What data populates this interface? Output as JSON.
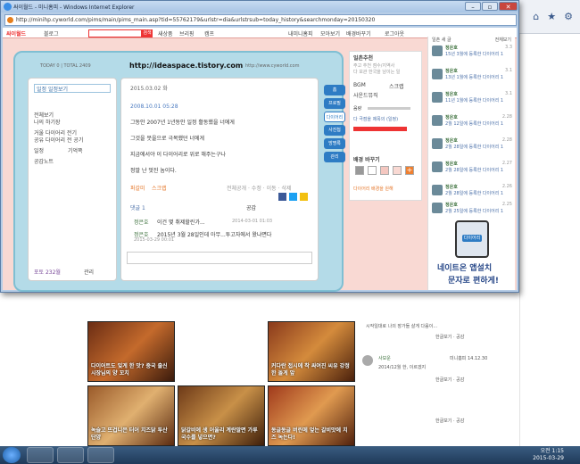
{
  "browser": {
    "window_title": "싸이월드 - 미니홈피 - Windows Internet Explorer",
    "address": "http://minihp.cyworld.com/pims/main/pims_main.asp?tid=55762179&urlstr=dia&urlstrsub=today_history&searchmonday=20150320",
    "minimize": "–",
    "restore": "▫",
    "close": "✕"
  },
  "cyworld_bar": {
    "logo": "싸이월드",
    "blog": "블로그",
    "search_button": "검색",
    "links": [
      "새상품",
      "브리핑",
      "캠프"
    ],
    "right_links": [
      "내미니홈피",
      "모아보기",
      "배경바꾸기",
      "로그아웃"
    ]
  },
  "minihompy": {
    "visitor": "TODAY 0 | TOTAL 2409",
    "url": "http://ideaspace.tistory.com",
    "domain": "http://www.cyworld.com",
    "folder_label": "일정 일정보기",
    "left_menu": [
      "전체보기",
      "나의 하기장",
      "거울 다이어리 전기",
      "공유 다이어리 전 공기",
      "일정",
      "기억쪽",
      "공감노트"
    ],
    "tabs": [
      "홈",
      "프로필",
      "다이어리",
      "사진첩",
      "방명록",
      "관리"
    ],
    "photo_count": "포토 232월",
    "admin": "관리",
    "post": {
      "header_date": "2015.03.02 화",
      "datetime": "2008.10.01 05:28",
      "lines": [
        "그동안 2007년 1년동안 일정 활동했을 너에게",
        "그것을 뭇을으로 극복했던 너에게",
        "지금에서야 이 다이어리로 위로 해주는구나",
        "정말 난 멋진 놈이다."
      ],
      "actions": [
        "퍼갈미",
        "스크랩"
      ],
      "controls": "전체공개 · 수정 · 이동 · 삭제",
      "comment_label": "댓글 1",
      "like": "공감",
      "comments": [
        {
          "author": "정은호",
          "text": "이건 몇 취제할린가...",
          "date": "2014-03-01 01:03"
        },
        {
          "author": "정은호",
          "text": "2015년 3월 28일인데 아무...투고자에서 왔냐면다",
          "date": "2015-03-29 00:01"
        }
      ]
    }
  },
  "right_panel": {
    "title": "일촌추천",
    "desc": [
      "주고 추천 점수/지역사",
      "다 보관 한국을 남이는 일"
    ],
    "bgm": "BGM",
    "scrap": "스크랩",
    "music": "사운드뮤직",
    "volume": "음량",
    "player": "다 극점을 제목의 (일정)",
    "skin": "배경 바꾸기",
    "footer": "다이어리 배경을 원해"
  },
  "friends": {
    "header": "일촌 새 글",
    "more": "전체보기",
    "items": [
      {
        "name": "정은호",
        "msg": "15년 3월에 등록한 다이어리 1",
        "date": "3.3"
      },
      {
        "name": "정은호",
        "msg": "13년 1월에 등록한 다이어리 1",
        "date": "3.1"
      },
      {
        "name": "정은호",
        "msg": "11년 1월에 등록한 다이어리 1",
        "date": "3.1"
      },
      {
        "name": "정은호",
        "msg": "2월 12일에 등록한 다이어리 1",
        "date": "2.28"
      },
      {
        "name": "정은호",
        "msg": "2월 28일에 등록한 다이어리 1",
        "date": "2.28"
      },
      {
        "name": "정은호",
        "msg": "2월 28일에 등록한 다이어리 1",
        "date": "2.27"
      },
      {
        "name": "정은호",
        "msg": "2월 28일에 등록한 다이어리 1",
        "date": "2.26"
      },
      {
        "name": "정은호",
        "msg": "2월 25일에 등록한 다이어리 1",
        "date": "2.25"
      }
    ],
    "ad_button": "다이어리",
    "ad_title": "네이트온 앱설치",
    "ad_sub": "문자로 편하게!"
  },
  "background": {
    "food": [
      "다이어트도 잊게 한 맛? 중국 출신 시장님의 양 꼬치",
      "커다란 접시에 착 싸여진 씨유 강정한 돌게 앞",
      "녹슬고 뜨겁니은 터어 치즈닭 투산 단양",
      "닭갈비에 생 어울리 계란말면 가루국수를 넣으면?",
      "동글동글 버린에 엎는 갈비맛에 치즈 녹는다!"
    ],
    "sidebar": [
      {
        "text": "시작일대로 나의 장가들 살게 다음이...",
        "meta": "한글보기 · 공감"
      },
      {
        "author": "사보운",
        "date": "미니홈피 14.12.30",
        "text": "2014/12월 한, 이르겠지",
        "meta": "한글보기 · 공감"
      },
      {
        "meta": "한글보기 · 공감"
      }
    ]
  },
  "taskbar": {
    "time": "오전 1:15",
    "date": "2015-03-29"
  },
  "colors": {
    "pink": "#f9d9d3",
    "mini_blue": "#b4dbe8",
    "cy_red": "#e33333",
    "tab_blue": "#2e7cc4"
  }
}
